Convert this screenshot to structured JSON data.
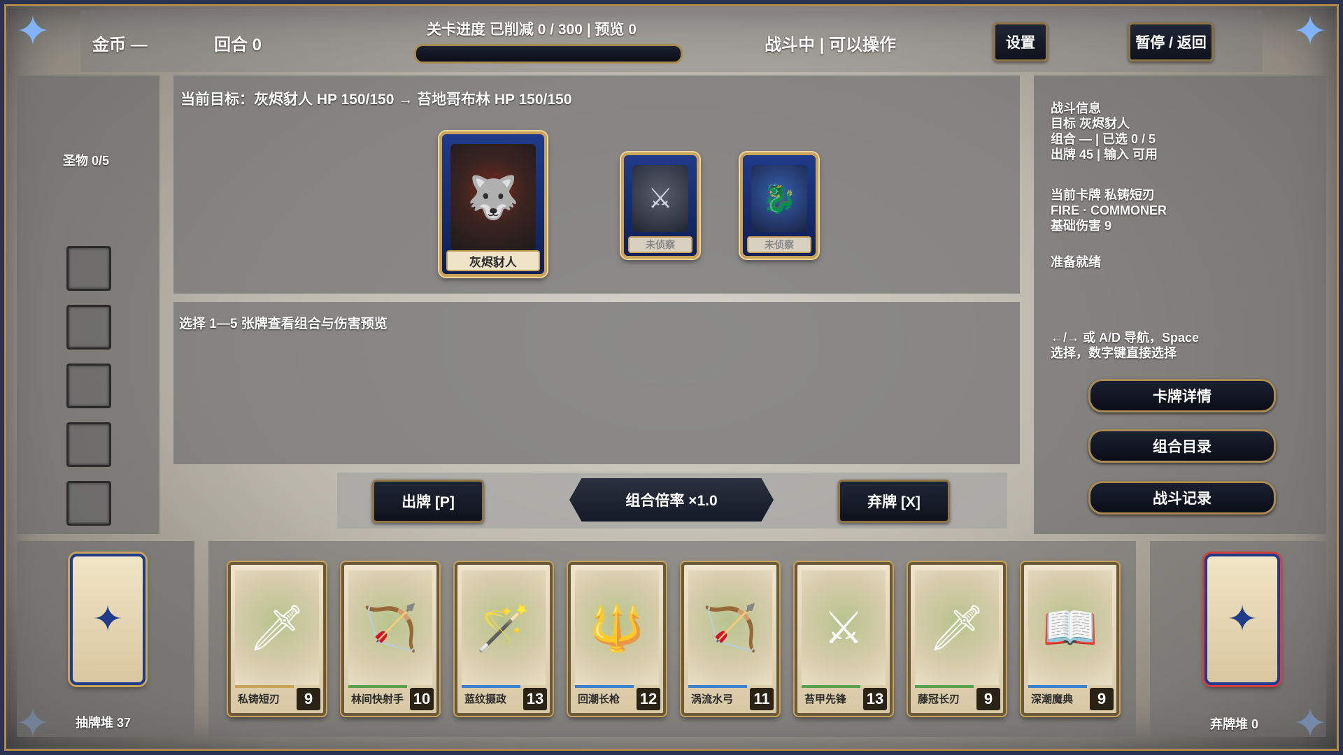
{
  "topbar": {
    "gold": "金币 —",
    "round": "回合  0",
    "progress": "关卡进度  已削减 0 / 300  |  预览 0",
    "progress_fraction": 0,
    "status": "战斗中  |  可以操作",
    "settings_label": "设置",
    "pause_label": "暂停 / 返回"
  },
  "relics": {
    "title": "圣物 0/5",
    "slot_count": 5
  },
  "target": {
    "line": "当前目标：灰烬豺人  HP 150/150  →  苔地哥布林  HP 150/150",
    "enemies": [
      {
        "name": "灰烬豺人",
        "icon": "jackal-warrior-icon"
      },
      {
        "name": "未侦察",
        "icon": "unscouted-enemy-icon"
      },
      {
        "name": "未侦察",
        "icon": "unscouted-enemy-icon"
      }
    ]
  },
  "combo": {
    "hint": "选择 1—5 张牌查看组合与伤害预览"
  },
  "actions": {
    "play_label": "出牌  [P]",
    "multiplier_label": "组合倍率  ×1.0",
    "discard_label": "弃牌  [X]"
  },
  "info": {
    "battle_title": "战斗信息",
    "battle_target": "目标  灰烬豺人",
    "battle_combo": "组合  —  |  已选 0 / 5",
    "battle_play": "出牌 45  |  输入 可用",
    "card_title": "当前卡牌  私铸短刃",
    "card_type": "FIRE · COMMONER",
    "card_damage": "基础伤害  9",
    "ready": "准备就绪",
    "nav_line1": "←/→ 或 A/D 导航，Space",
    "nav_line2": "选择，数字键直接选择"
  },
  "side_buttons": {
    "card_detail": "卡牌详情",
    "combo_list": "组合目录",
    "battle_log": "战斗记录"
  },
  "piles": {
    "draw_label": "抽牌堆  37",
    "discard_label": "弃牌堆  0"
  },
  "hand": [
    {
      "name": "私铸短刃",
      "cost": "9",
      "stripe": "#c9a35a"
    },
    {
      "name": "林间快射手",
      "cost": "10",
      "stripe": "#5aa04a"
    },
    {
      "name": "蓝纹摄政",
      "cost": "13",
      "stripe": "#3b7fd0"
    },
    {
      "name": "回潮长枪",
      "cost": "12",
      "stripe": "#3b7fd0"
    },
    {
      "name": "涡流水弓",
      "cost": "11",
      "stripe": "#3b7fd0"
    },
    {
      "name": "苔甲先锋",
      "cost": "13",
      "stripe": "#5aa04a"
    },
    {
      "name": "藤冠长刃",
      "cost": "9",
      "stripe": "#5aa04a"
    },
    {
      "name": "深潮魔典",
      "cost": "9",
      "stripe": "#3b7fd0"
    }
  ]
}
